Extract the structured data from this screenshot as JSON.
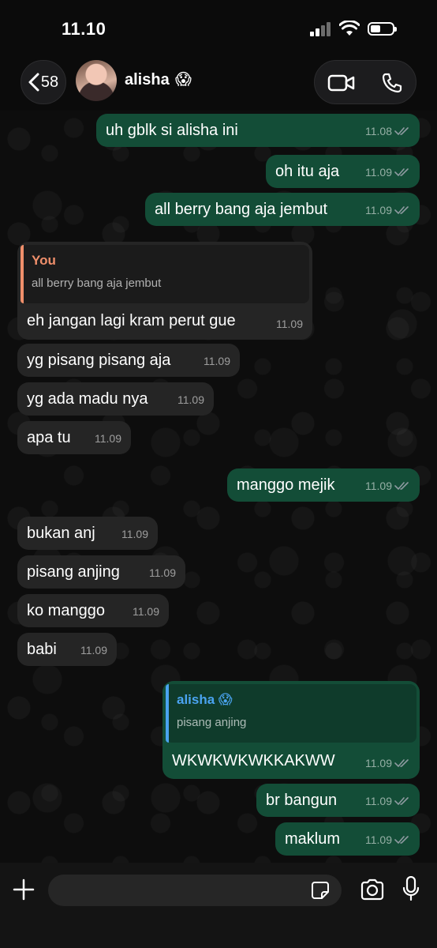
{
  "status_bar": {
    "time": "11.10"
  },
  "header": {
    "back_count": "58",
    "contact_name": "alisha",
    "contact_emoji": "😱"
  },
  "messages": [
    {
      "direction": "out",
      "text": "uh gblk si alisha ini",
      "time": "11.08",
      "read": true
    },
    {
      "direction": "out",
      "text": "oh itu aja",
      "time": "11.09",
      "read": true
    },
    {
      "direction": "out",
      "text": "all berry bang aja jembut",
      "time": "11.09",
      "read": true
    },
    {
      "direction": "in",
      "reply_to": {
        "name": "You",
        "text": "all berry bang aja jembut"
      },
      "text": "eh jangan lagi kram perut gue",
      "time": "11.09"
    },
    {
      "direction": "in",
      "text": "yg pisang pisang aja",
      "time": "11.09"
    },
    {
      "direction": "in",
      "text": "yg ada madu nya",
      "time": "11.09"
    },
    {
      "direction": "in",
      "text": "apa tu",
      "time": "11.09"
    },
    {
      "direction": "out",
      "text": "manggo mejik",
      "time": "11.09",
      "read": true
    },
    {
      "direction": "in",
      "text": "bukan anj",
      "time": "11.09"
    },
    {
      "direction": "in",
      "text": "pisang anjing",
      "time": "11.09"
    },
    {
      "direction": "in",
      "text": "ko manggo",
      "time": "11.09"
    },
    {
      "direction": "in",
      "text": "babi",
      "time": "11.09"
    },
    {
      "direction": "out",
      "reply_to": {
        "name": "alisha 😱",
        "text": "pisang anjing"
      },
      "text": "WKWKWKWKKAKWW",
      "time": "11.09",
      "read": true
    },
    {
      "direction": "out",
      "text": "br bangun",
      "time": "11.09",
      "read": true
    },
    {
      "direction": "out",
      "text": "maklum",
      "time": "11.09",
      "read": true
    }
  ],
  "input": {
    "placeholder": ""
  },
  "colors": {
    "outgoing_bubble": "#134d37",
    "incoming_bubble": "#252525",
    "read_tick": "#8e9aa0",
    "quote_you": "#ef8f6b",
    "quote_contact": "#4aa3f0"
  },
  "icons": [
    "back-chevron-icon",
    "video-call-icon",
    "phone-call-icon",
    "plus-icon",
    "sticker-icon",
    "camera-icon",
    "microphone-icon",
    "double-check-icon"
  ]
}
